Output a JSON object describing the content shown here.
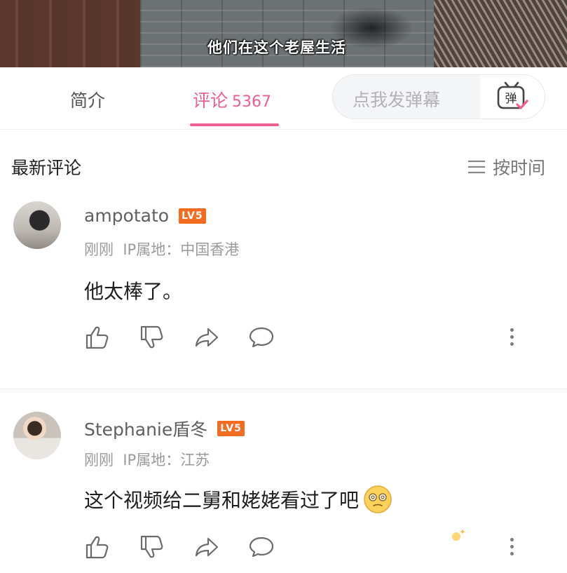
{
  "video": {
    "subtitle": "他们在这个老屋生活"
  },
  "tabs": {
    "intro_label": "简介",
    "comments_label": "评论",
    "comments_count": "5367",
    "danmaku_placeholder": "点我发弹幕",
    "danmaku_icon_text": "弹",
    "accent_color": "#ee5e92"
  },
  "comments_header": {
    "title": "最新评论",
    "sort_label": "按时间"
  },
  "comments": [
    {
      "username": "ampotato",
      "level": "LV5",
      "time": "刚刚",
      "ip_location": "IP属地：中国香港",
      "text": "他太棒了。"
    },
    {
      "username": "Stephanie盾冬",
      "level": "LV5",
      "time": "刚刚",
      "ip_location": "IP属地：江苏",
      "text": "这个视频给二舅和姥姥看过了吧"
    }
  ],
  "icons": {
    "like": "thumbs-up-icon",
    "dislike": "thumbs-down-icon",
    "share": "share-icon",
    "reply": "comment-icon",
    "more": "more-vertical-icon",
    "sort": "sort-lines-icon",
    "danmaku": "danmaku-tv-icon",
    "emoji": "dizzy-face-emoji-icon"
  }
}
